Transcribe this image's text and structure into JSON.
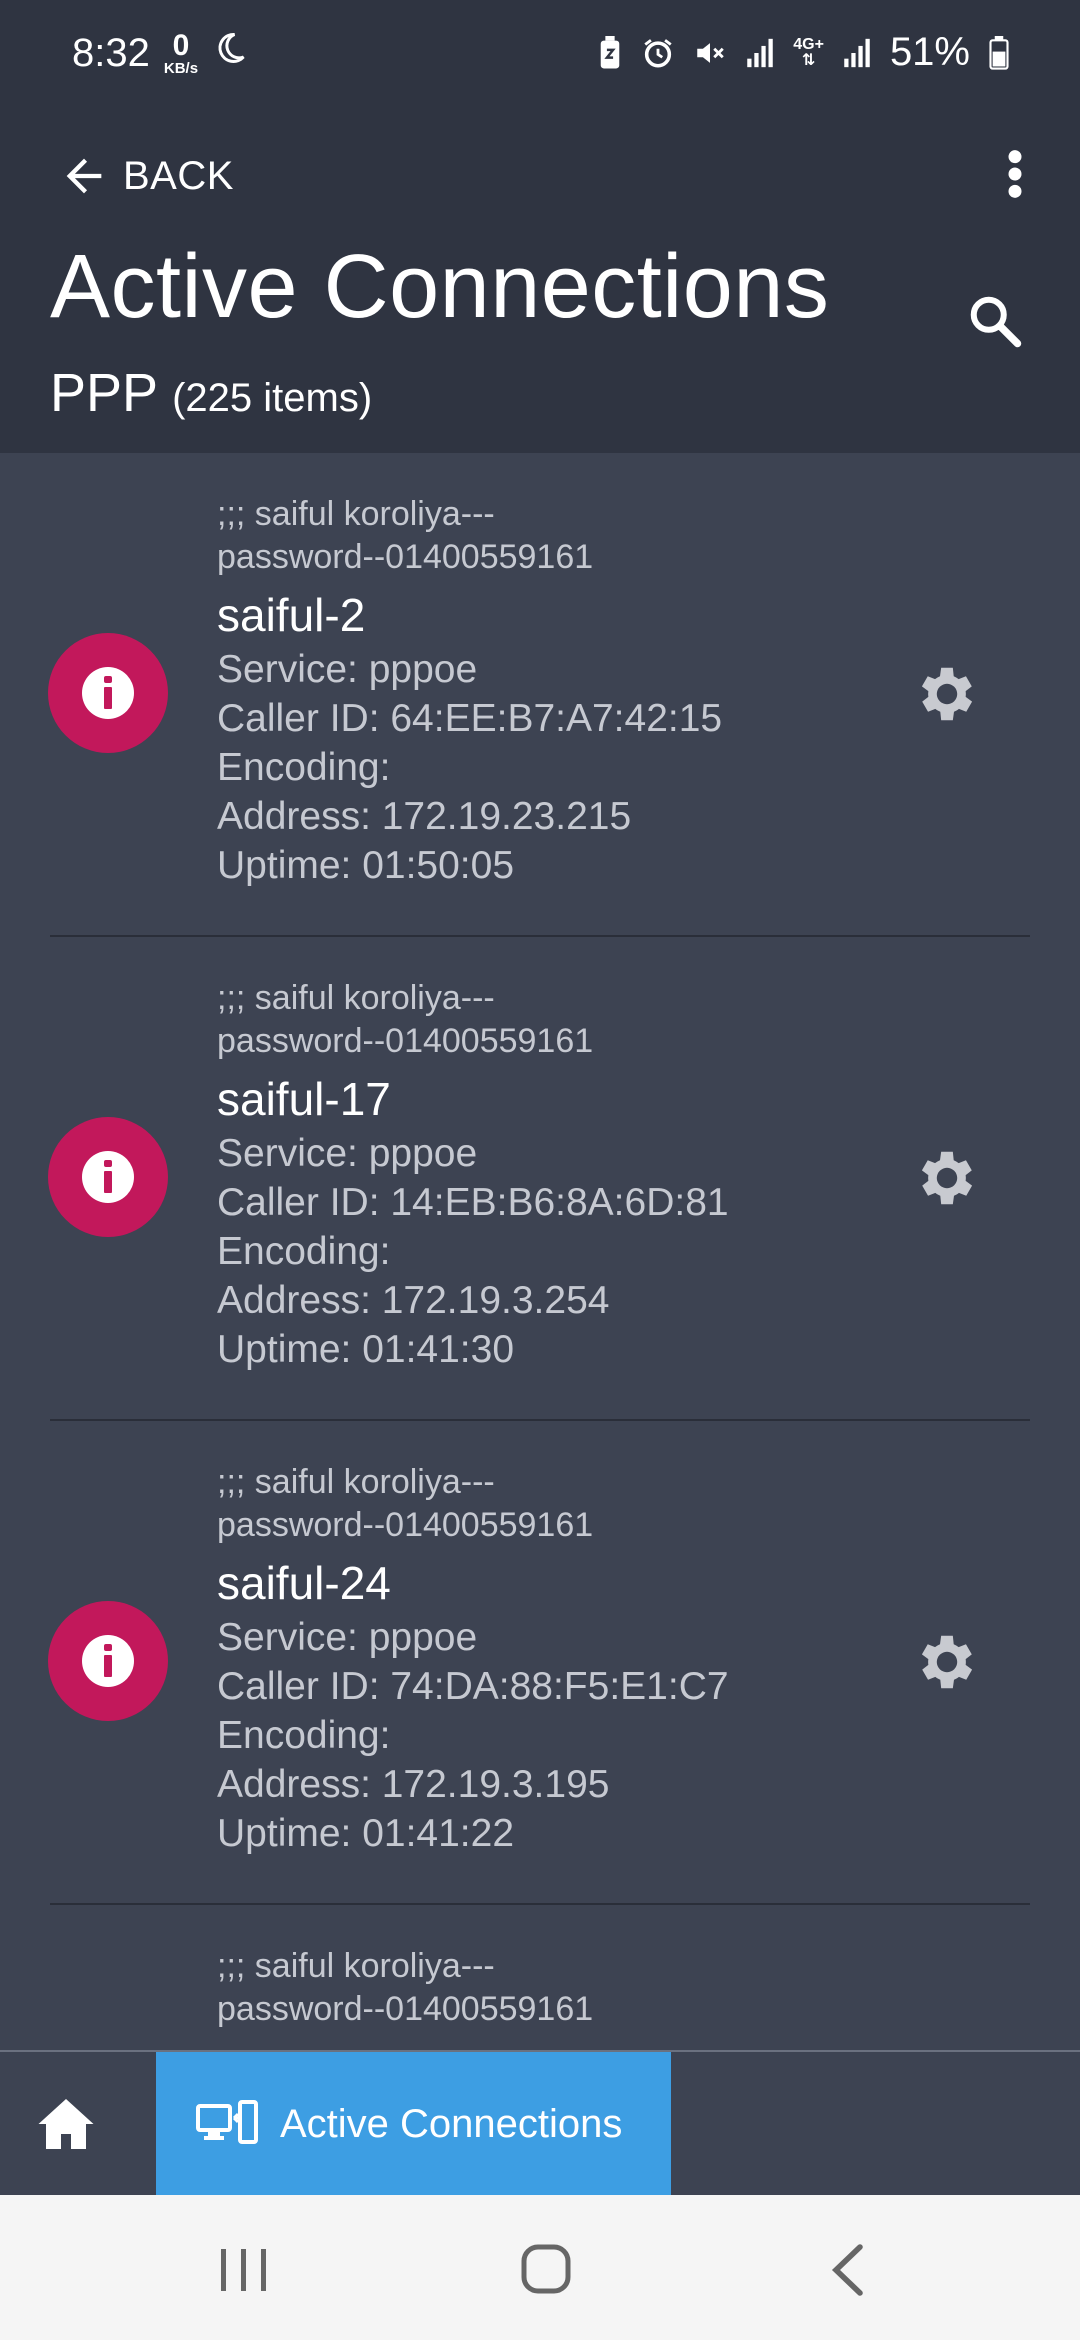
{
  "status": {
    "time": "8:32",
    "net_speed_value": "0",
    "net_speed_unit": "KB/s",
    "network_type": "4G+",
    "battery": "51%"
  },
  "toolbar": {
    "back_label": "BACK",
    "title": "Active Connections",
    "subtitle": "PPP",
    "item_count": "(225 items)"
  },
  "connections": [
    {
      "comment_line1": ";;; saiful koroliya---",
      "comment_line2": "password--01400559161",
      "name": "saiful-2",
      "service": "Service: pppoe",
      "caller_id": "Caller ID: 64:EE:B7:A7:42:15",
      "encoding": "Encoding:",
      "address": "Address: 172.19.23.215",
      "uptime": "Uptime: 01:50:05"
    },
    {
      "comment_line1": ";;; saiful koroliya---",
      "comment_line2": "password--01400559161",
      "name": "saiful-17",
      "service": "Service: pppoe",
      "caller_id": "Caller ID: 14:EB:B6:8A:6D:81",
      "encoding": "Encoding:",
      "address": "Address: 172.19.3.254",
      "uptime": "Uptime: 01:41:30"
    },
    {
      "comment_line1": ";;; saiful koroliya---",
      "comment_line2": "password--01400559161",
      "name": "saiful-24",
      "service": "Service: pppoe",
      "caller_id": "Caller ID: 74:DA:88:F5:E1:C7",
      "encoding": "Encoding:",
      "address": "Address: 172.19.3.195",
      "uptime": "Uptime: 01:41:22"
    },
    {
      "comment_line1": ";;; saiful koroliya---",
      "comment_line2": "password--01400559161"
    }
  ],
  "bottom_nav": {
    "active_tab_label": "Active Connections"
  },
  "icons": {
    "back": "arrow-back-icon",
    "more": "more-vert-icon",
    "search": "search-icon",
    "info": "info-icon",
    "settings": "gear-icon",
    "home": "home-icon",
    "connections": "computer-network-icon"
  },
  "colors": {
    "header_bg": "#2f3441",
    "list_bg": "#3d4352",
    "info_badge": "#c2185b",
    "active_tab": "#3d9ee3"
  }
}
